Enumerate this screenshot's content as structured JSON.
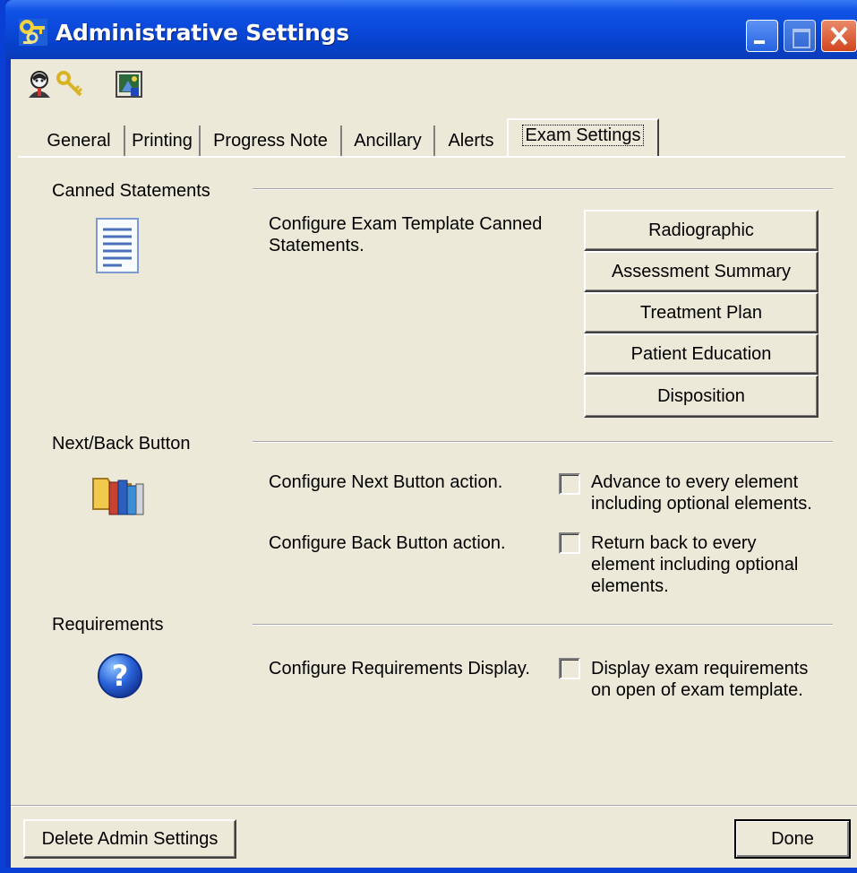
{
  "window": {
    "title": "Administrative Settings"
  },
  "toolbar": {
    "icons": [
      "user-icon",
      "key-icon",
      "image-icon"
    ]
  },
  "tabs": [
    {
      "label": "General",
      "active": false
    },
    {
      "label": "Printing",
      "active": false
    },
    {
      "label": "Progress Note",
      "active": false
    },
    {
      "label": "Ancillary",
      "active": false
    },
    {
      "label": "Alerts",
      "active": false
    },
    {
      "label": "Exam Settings",
      "active": true
    }
  ],
  "canned": {
    "label": "Canned Statements",
    "icon": "document-icon",
    "description": "Configure Exam Template Canned Statements.",
    "buttons": [
      "Radiographic",
      "Assessment Summary",
      "Treatment Plan",
      "Patient Education",
      "Disposition"
    ]
  },
  "nextback": {
    "label": "Next/Back Button",
    "icon": "folder-books-icon",
    "next_description": "Configure Next Button action.",
    "next_option": "Advance to every element including optional elements.",
    "next_checked": false,
    "back_description": "Configure Back Button action.",
    "back_option": "Return back to every element including optional elements.",
    "back_checked": false
  },
  "requirements": {
    "label": "Requirements",
    "icon": "help-icon",
    "description": "Configure Requirements Display.",
    "option": "Display exam requirements on open of exam template.",
    "checked": false
  },
  "footer": {
    "delete_label": "Delete Admin Settings",
    "done_label": "Done"
  },
  "colors": {
    "titlebar": "#0a48d9",
    "window_bg": "#ece9d8",
    "close_button": "#d2461e"
  }
}
